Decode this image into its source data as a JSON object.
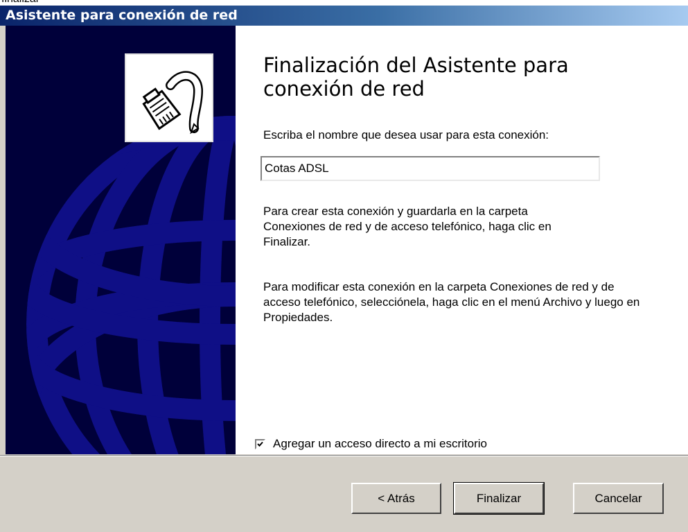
{
  "top_text": "finalizar",
  "window": {
    "title": "Asistente para conexión de red"
  },
  "main": {
    "heading": "Finalización del Asistente para conexión de red",
    "prompt_label": "Escriba el nombre que desea usar para esta conexión:",
    "connection_name": "Cotas ADSL",
    "paragraph1": "Para crear esta conexión y guardarla en la carpeta Conexiones de red y de acceso telefónico, haga clic en Finalizar.",
    "paragraph2": "Para modificar esta conexión en la carpeta Conexiones de red y de acceso telefónico, selecciónela, haga clic en el menú Archivo y luego en Propiedades.",
    "shortcut_checkbox": {
      "label": "Agregar un acceso directo a mi escritorio",
      "checked": true
    }
  },
  "buttons": {
    "back": "< Atrás",
    "finish": "Finalizar",
    "cancel": "Cancelar"
  },
  "icons": {
    "side_panel": "globe-graphic",
    "wizard": "network-cable-icon",
    "checkbox": "checkmark-icon"
  },
  "colors": {
    "titlebar_start": "#0a246a",
    "titlebar_end": "#a6caf0",
    "side_panel_background": "#00003a",
    "globe": "#0f0f86",
    "dialog_background": "#d4d0c8"
  }
}
